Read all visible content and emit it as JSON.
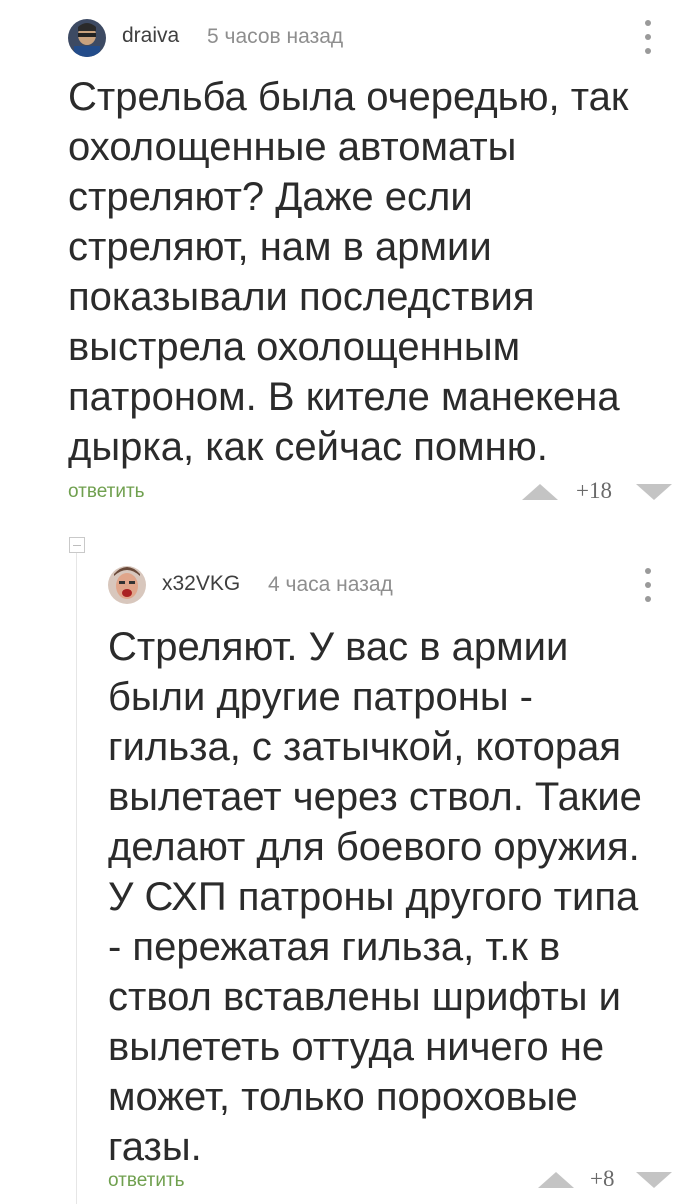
{
  "comments": [
    {
      "username": "draiva",
      "timestamp": "5 часов назад",
      "text": "Стрельба была очередью, так\nохолощенные автоматы\nстреляют? Даже если\nстреляют, нам в армии\nпоказывали последствия\nвыстрела охолощенным\nпатроном. В кителе манекена\nдырка, как сейчас помню.",
      "reply_label": "ответить",
      "rating": "+18"
    },
    {
      "username": "x32VKG",
      "timestamp": "4 часа назад",
      "text": "Стреляют. У вас в армии\nбыли другие патроны -\nгильза, с затычкой, которая\nвылетает через ствол. Такие\nделают для боевого оружия.\nУ СХП патроны другого типа\n- пережатая гильза, т.к в\nствол вставлены шрифты и\nвылететь оттуда ничего не\nможет, только пороховые\nгазы.",
      "reply_label": "ответить",
      "rating": "+8"
    }
  ],
  "colors": {
    "reply": "#70a04f",
    "text": "#2b2b2b",
    "meta": "#8e8e8e",
    "vote_icon": "#c4c4c4"
  },
  "icons": {
    "avatar_1": "avatar-icon",
    "avatar_2": "avatar-icon",
    "more": "more-vertical-icon",
    "upvote": "triangle-up-icon",
    "downvote": "triangle-down-icon",
    "collapse": "collapse-thread-icon"
  }
}
